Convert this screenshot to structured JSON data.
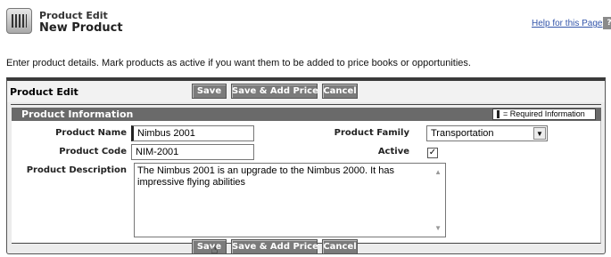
{
  "header": {
    "subtitle": "Product Edit",
    "title": "New Product",
    "help_link": "Help for this Page",
    "help_icon_glyph": "?"
  },
  "intro": "Enter product details. Mark products as active if you want them to be added to price books or opportunities.",
  "edit_section": {
    "title": "Product Edit",
    "buttons": {
      "save": "Save",
      "save_add_price": "Save & Add Price",
      "cancel": "Cancel"
    }
  },
  "info": {
    "title": "Product Information",
    "required_legend": "= Required Information"
  },
  "fields": {
    "product_name_label": "Product Name",
    "product_name_value": "Nimbus 2001",
    "product_code_label": "Product Code",
    "product_code_value": "NIM-2001",
    "product_family_label": "Product Family",
    "product_family_value": "Transportation",
    "active_label": "Active",
    "active_checked": true,
    "active_mark": "✓",
    "description_label": "Product Description",
    "description_value": "The Nimbus 2001 is an upgrade to the Nimbus 2000. It has impressive flying abilities"
  },
  "icons": {
    "product": "product-barcode-icon",
    "help": "help-icon",
    "dropdown": "chevron-down-icon",
    "cursor": "hand-cursor-icon"
  },
  "colors": {
    "button": "#7b7b7b",
    "info_header": "#6a6a6a",
    "link": "#3355aa"
  }
}
